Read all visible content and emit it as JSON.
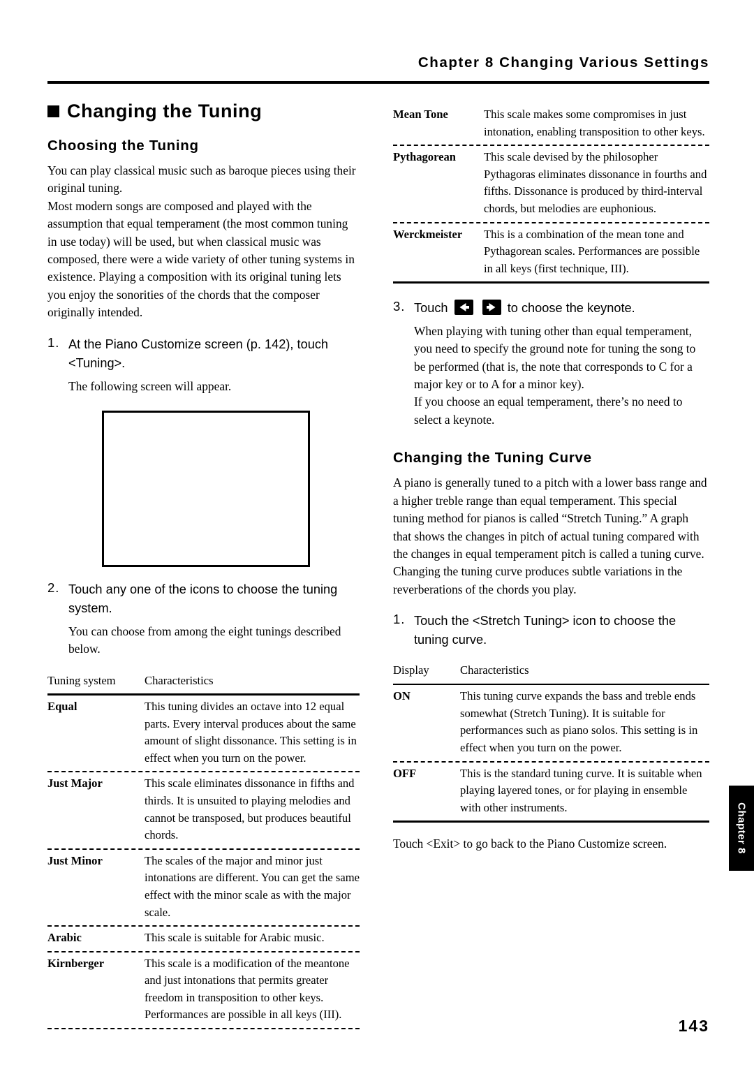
{
  "header": {
    "chapter_title": "Chapter 8  Changing Various Settings"
  },
  "page_number": "143",
  "chapter_tab": "Chapter 8",
  "left": {
    "h1": "Changing the Tuning",
    "h2_choosing": "Choosing the Tuning",
    "intro_p1": "You can play classical music such as baroque pieces using their original tuning.",
    "intro_p2": "Most modern songs are composed and played with the assumption that equal temperament (the most common tuning in use today) will be used, but when classical music was composed, there were a wide variety of other tuning systems in existence. Playing a composition with its original tuning lets you enjoy the sonorities of the chords that the composer originally intended.",
    "step1_num": "1.",
    "step1_text": "At the Piano Customize screen (p. 142), touch <Tuning>.",
    "step1_body": "The following screen will appear.",
    "step2_num": "2.",
    "step2_text": "Touch any one of the icons to choose the tuning system.",
    "step2_body": "You can choose from among the eight tunings described below.",
    "table": {
      "head_term": "Tuning system",
      "head_desc": "Characteristics",
      "rows": [
        {
          "term": "Equal",
          "desc": "This tuning divides an octave into 12 equal parts. Every interval produces about the same amount of slight dissonance. This setting is in effect when you turn on the power."
        },
        {
          "term": "Just Major",
          "desc": "This scale eliminates dissonance in fifths and thirds. It is unsuited to playing melodies and cannot be transposed, but produces beautiful chords."
        },
        {
          "term": "Just Minor",
          "desc": "The scales of the major and minor just intonations are different. You can get the same effect with the minor scale as with the major scale."
        },
        {
          "term": "Arabic",
          "desc": "This scale is suitable for Arabic music."
        },
        {
          "term": "Kirnberger",
          "desc": "This scale is a modification of the meantone and just intonations that permits greater freedom in transposition to other keys. Performances are possible in all keys (III)."
        }
      ]
    }
  },
  "right": {
    "table_top": {
      "rows": [
        {
          "term": "Mean Tone",
          "desc": "This scale makes some compromises in just intonation, enabling transposition to other keys."
        },
        {
          "term": "Pythagorean",
          "desc": "This scale devised by the philosopher Pythagoras eliminates dissonance in fourths and fifths. Dissonance is produced by third-interval chords, but melodies are euphonious."
        },
        {
          "term": "Werckmeister",
          "desc": "This is a combination of the mean tone and Pythagorean scales. Performances are possible in all keys (first technique, III)."
        }
      ]
    },
    "step3_num": "3.",
    "step3_text_a": "Touch",
    "step3_text_b": "to choose the keynote.",
    "step3_body_1": "When playing with tuning other than equal temperament, you need to specify the ground note for tuning the song to be performed (that is, the note that corresponds to C for a major key or to A for a minor key).",
    "step3_body_2": "If you choose an equal temperament, there’s no need to select a keynote.",
    "h2_curve": "Changing the Tuning Curve",
    "curve_p1": "A piano is generally tuned to a pitch with a lower bass range and a higher treble range than equal temperament. This special tuning method for pianos is called “Stretch Tuning.” A graph that shows the changes in pitch of actual tuning compared with the changes in equal temperament pitch is called a tuning curve. Changing the tuning curve produces subtle variations in the reverberations of the chords you play.",
    "step1_num": "1.",
    "step1_text": "Touch the <Stretch Tuning> icon to choose the tuning curve.",
    "table_bottom": {
      "head_term": "Display",
      "head_desc": "Characteristics",
      "rows": [
        {
          "term": "ON",
          "desc": "This tuning curve expands the bass and treble ends somewhat (Stretch Tuning). It is suitable for performances such as piano solos. This setting is in effect when you turn on the power."
        },
        {
          "term": "OFF",
          "desc": "This is the standard tuning curve. It is suitable when playing layered tones, or for playing in ensemble with other instruments."
        }
      ]
    },
    "closing": "Touch <Exit> to go back to the Piano Customize screen."
  },
  "icons": {
    "left_arrow": "left-arrow-icon",
    "right_arrow": "right-arrow-icon"
  }
}
